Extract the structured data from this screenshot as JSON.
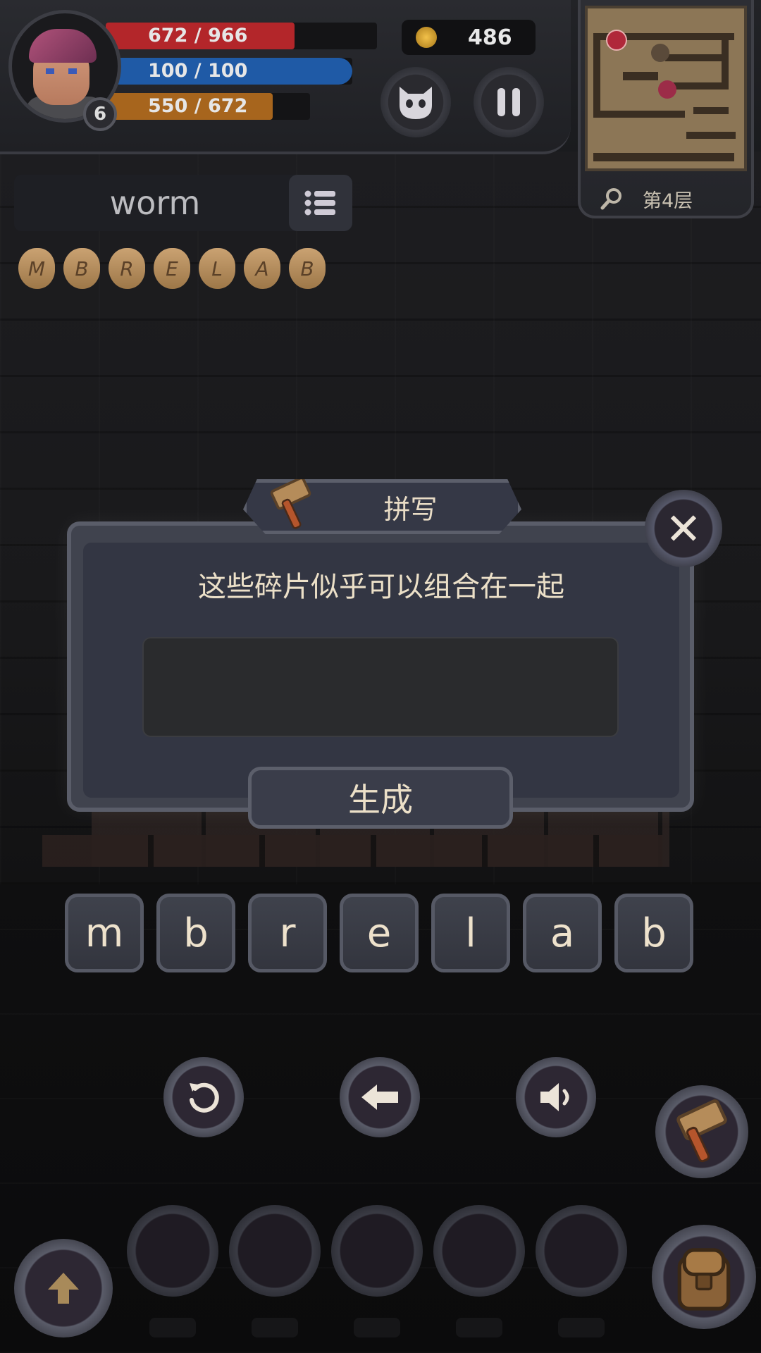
{
  "hud": {
    "hp": {
      "current": 672,
      "max": 966,
      "text": "672 / 966",
      "color": "#b3262a"
    },
    "mp": {
      "current": 100,
      "max": 100,
      "text": "100 / 100",
      "color": "#1f5aa6"
    },
    "xp": {
      "current": 550,
      "max": 672,
      "text": "550 / 672",
      "color": "#a7651d"
    },
    "level": "6",
    "gold": "486",
    "floor": "第4层"
  },
  "word_panel": {
    "word": "worm",
    "fragments": [
      "M",
      "B",
      "R",
      "E",
      "L",
      "A",
      "B"
    ]
  },
  "dialog": {
    "title": "拼写",
    "message": "这些碎片似乎可以组合在一起",
    "answer": "",
    "generate_label": "生成",
    "close_label": "✕"
  },
  "letters": [
    "m",
    "b",
    "r",
    "e",
    "l",
    "a",
    "b"
  ],
  "controls": {
    "reset": "reset-icon",
    "backspace": "backspace-arrow-icon",
    "sound": "speaker-icon"
  },
  "colors": {
    "accent_text": "#ece0c8",
    "panel": "#333643",
    "frame": "#5c5f6b"
  }
}
